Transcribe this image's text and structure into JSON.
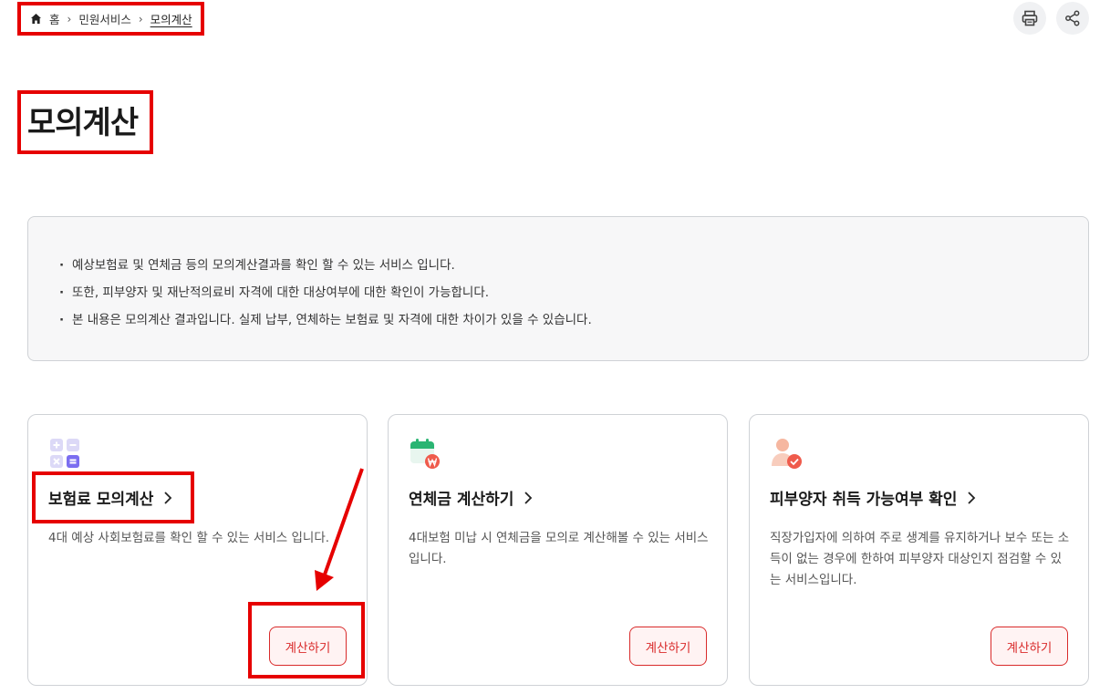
{
  "breadcrumb": {
    "home": "홈",
    "level1": "민원서비스",
    "current": "모의계산"
  },
  "toolbar": {
    "print_icon": "printer-icon",
    "share_icon": "share-icon"
  },
  "page": {
    "title": "모의계산"
  },
  "info": {
    "items": [
      "예상보험료 및 연체금 등의 모의계산결과를 확인 할 수 있는 서비스 입니다.",
      "또한, 피부양자 및 재난적의료비 자격에 대한 대상여부에 대한 확인이 가능합니다.",
      "본 내용은 모의계산 결과입니다. 실제 납부, 연체하는 보험료 및 자격에 대한 차이가 있을 수 있습니다."
    ]
  },
  "cards": [
    {
      "icon": "calculator-icon",
      "title": "보험료 모의계산",
      "desc": "4대 예상 사회보험료를 확인 할 수 있는 서비스 입니다.",
      "button": "계산하기"
    },
    {
      "icon": "calendar-won-icon",
      "title": "연체금 계산하기",
      "desc": "4대보험 미납 시 연체금을 모의로 계산해볼 수 있는 서비스입니다.",
      "button": "계산하기"
    },
    {
      "icon": "person-check-icon",
      "title": "피부양자 취득 가능여부 확인",
      "desc": "직장가입자에 의하여 주로 생계를 유지하거나 보수 또는 소득이 없는 경우에 한하여 피부양자 대상인지 점검할 수 있는 서비스입니다.",
      "button": "계산하기"
    }
  ],
  "colors": {
    "accent": "#d92b2b",
    "annotation": "#e60000"
  }
}
